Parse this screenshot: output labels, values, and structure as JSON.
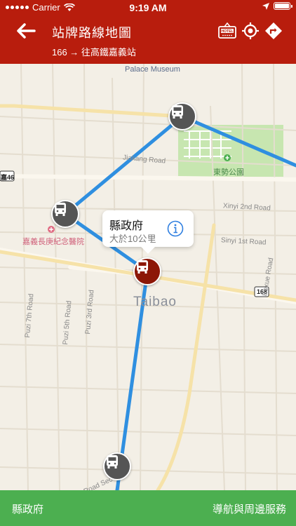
{
  "status": {
    "carrier": "Carrier",
    "time": "9:19 AM"
  },
  "header": {
    "title": "站牌路線地圖",
    "subtitle": "166 → 往高鐵嘉義站"
  },
  "map": {
    "labels": {
      "palace_museum": "Palace Museum",
      "jiakang": "Jiakang Road",
      "park": "東勢公園",
      "xinyi2": "Xinyi 2nd Road",
      "sinyi1": "Sinyi 1st Road",
      "hospital": "嘉義長庚紀念醫院",
      "taibao": "Taibao",
      "route168": "168",
      "route46": "嘉46",
      "puzi7": "Puzi 7th Road",
      "puzi5": "Puzi 5th Road",
      "puzi3": "Puzi 3rd Road",
      "boxue": "Boxue Road",
      "road_sec": "Road Sec"
    },
    "callout": {
      "title": "縣政府",
      "subtitle": "大於10公里"
    }
  },
  "bottom": {
    "stop_name": "縣政府",
    "action": "導航與周邊服務"
  },
  "colors": {
    "header": "#b81d0d",
    "route": "#2f8fe0",
    "stop": "#555555",
    "active_stop": "#8c1707",
    "bottom": "#4caf50"
  }
}
